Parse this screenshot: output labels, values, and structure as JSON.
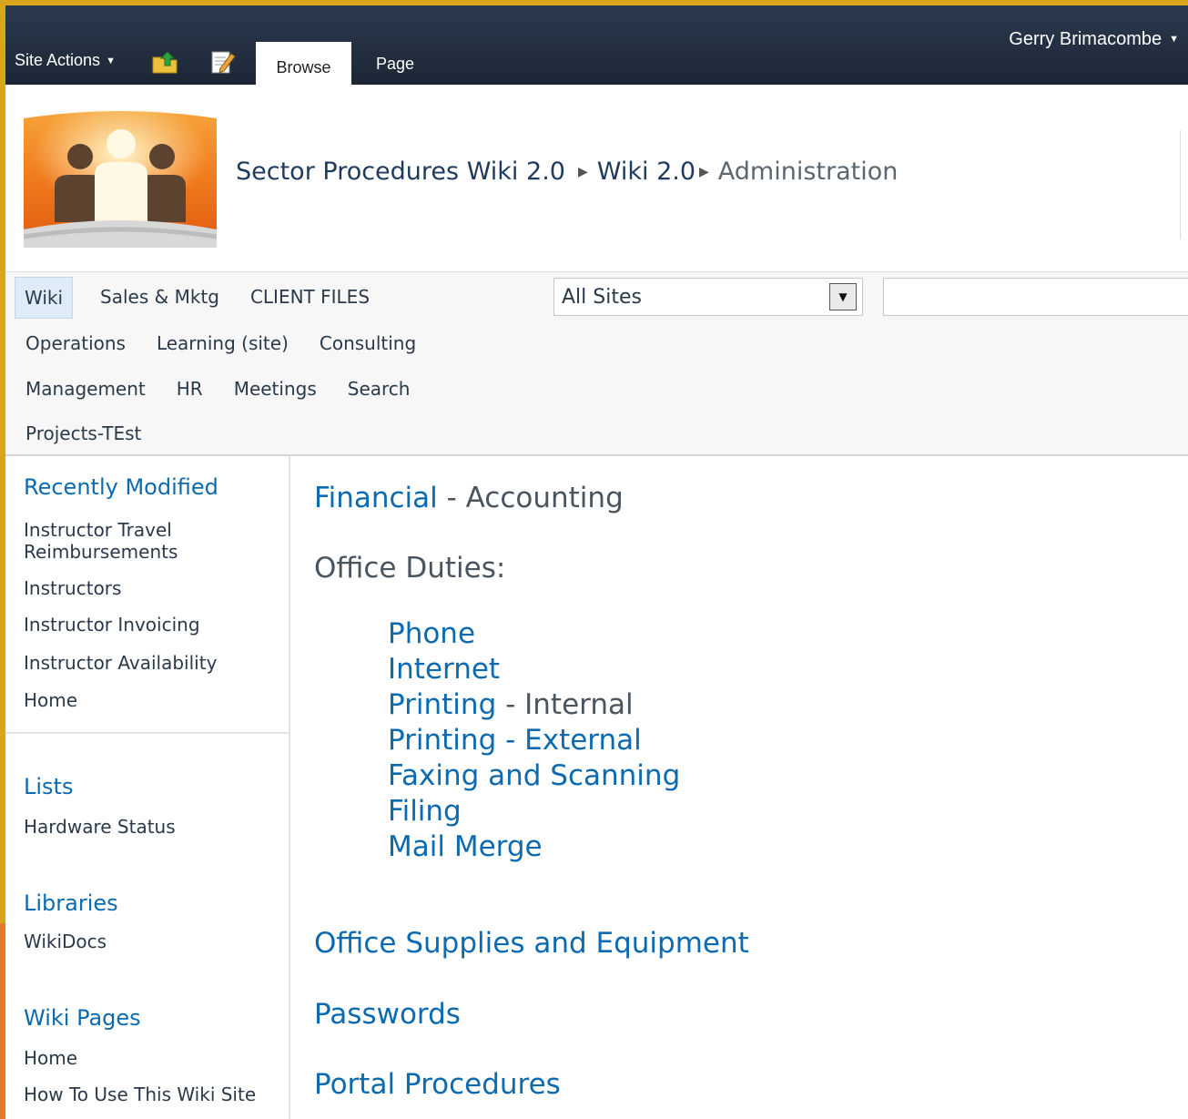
{
  "ribbon": {
    "site_actions": "Site Actions",
    "tabs": [
      "Browse",
      "Page"
    ],
    "user": "Gerry Brimacombe",
    "icons": [
      "navigate-up-icon",
      "edit-page-icon"
    ]
  },
  "header": {
    "breadcrumb": [
      "Sector Procedures Wiki 2.0",
      "Wiki 2.0",
      "Administration"
    ]
  },
  "topnav": {
    "rows": [
      [
        "Wiki",
        "Sales & Mktg",
        "CLIENT FILES"
      ],
      [
        "Operations",
        "Learning (site)",
        "Consulting"
      ],
      [
        "Management",
        "HR",
        "Meetings",
        "Search"
      ],
      [
        "Projects-TEst"
      ]
    ],
    "search_scope": "All Sites"
  },
  "leftnav": {
    "recently_modified": {
      "title": "Recently Modified",
      "items": [
        "Instructor Travel Reimbursements",
        "Instructors",
        "Instructor Invoicing",
        "Instructor Availability",
        "Home"
      ]
    },
    "lists": {
      "title": "Lists",
      "items": [
        "Hardware Status"
      ]
    },
    "libraries": {
      "title": "Libraries",
      "items": [
        "WikiDocs"
      ]
    },
    "wiki_pages": {
      "title": "Wiki Pages",
      "items": [
        "Home",
        "How To Use This Wiki Site"
      ]
    }
  },
  "content": {
    "financial_link": "Financial",
    "financial_suffix": " - Accounting",
    "office_duties": "Office Duties:",
    "duties": [
      {
        "link": "Phone",
        "suffix": ""
      },
      {
        "link": "Internet",
        "suffix": ""
      },
      {
        "link": "Printing",
        "suffix": " - Internal"
      },
      {
        "link": "Printing - External",
        "suffix": ""
      },
      {
        "link": "Faxing and Scanning",
        "suffix": ""
      },
      {
        "link": "Filing",
        "suffix": ""
      },
      {
        "link": "Mail Merge",
        "suffix": ""
      }
    ],
    "supplies": "Office Supplies and Equipment",
    "passwords": "Passwords",
    "portal": "Portal Procedures"
  },
  "colors": {
    "ribbon": "#1c2635",
    "link": "#0c6ab0",
    "frame": "#d9a51b"
  }
}
